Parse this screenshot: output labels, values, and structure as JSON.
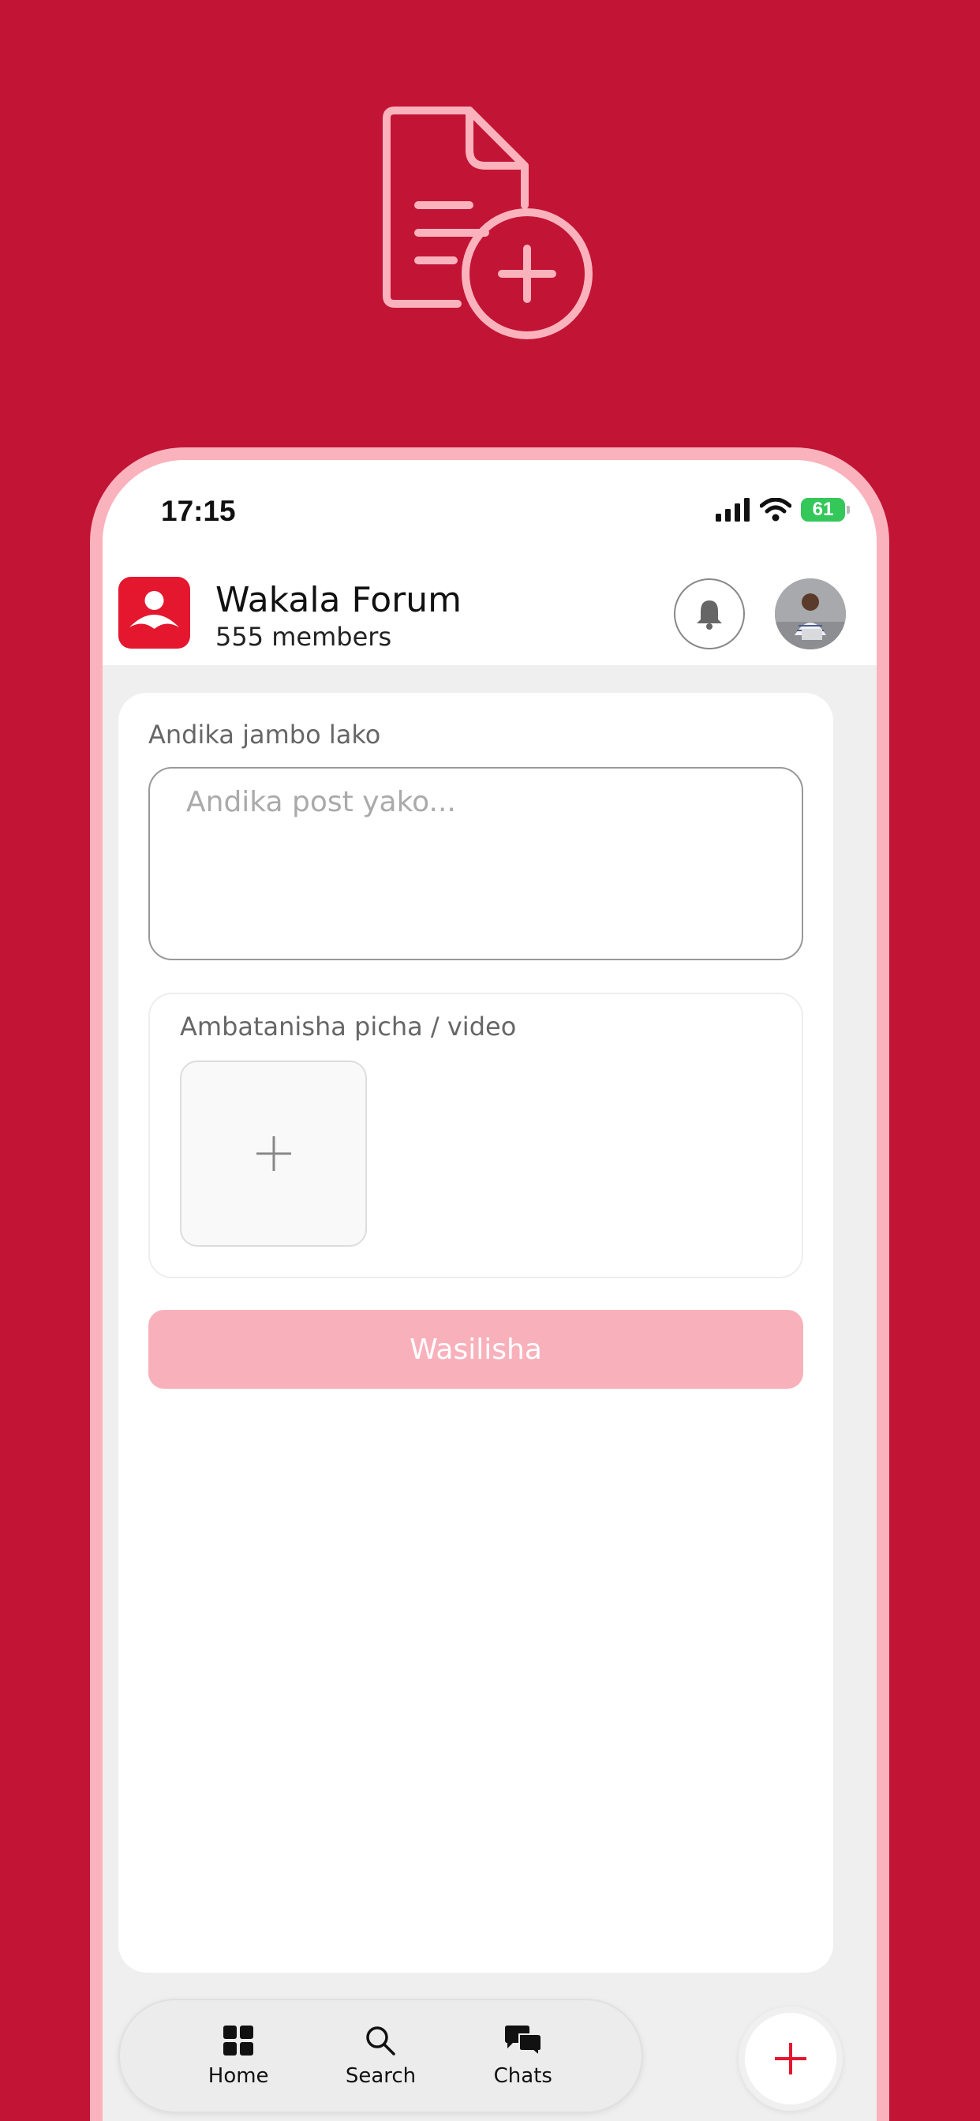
{
  "hero": {
    "icon": "document-add-icon",
    "color": "#fab2bc"
  },
  "status_bar": {
    "time": "17:15",
    "battery": "61"
  },
  "header": {
    "title": "Wakala Forum",
    "subtitle": "555 members",
    "logo_icon": "person-logo-icon",
    "brand_color": "#e4172f"
  },
  "form": {
    "write_label": "Andika jambo lako",
    "post_placeholder": "Andika post yako...",
    "post_value": "",
    "attach_label": "Ambatanisha picha / video",
    "submit_label": "Wasilisha",
    "submit_color": "#f8b1bb"
  },
  "tabs": [
    {
      "label": "Home",
      "icon": "grid-icon"
    },
    {
      "label": "Search",
      "icon": "search-icon"
    },
    {
      "label": "Chats",
      "icon": "chat-bubbles-icon"
    }
  ],
  "fab": {
    "icon": "plus-icon",
    "color": "#e4172f"
  },
  "background_color": "#c21435"
}
